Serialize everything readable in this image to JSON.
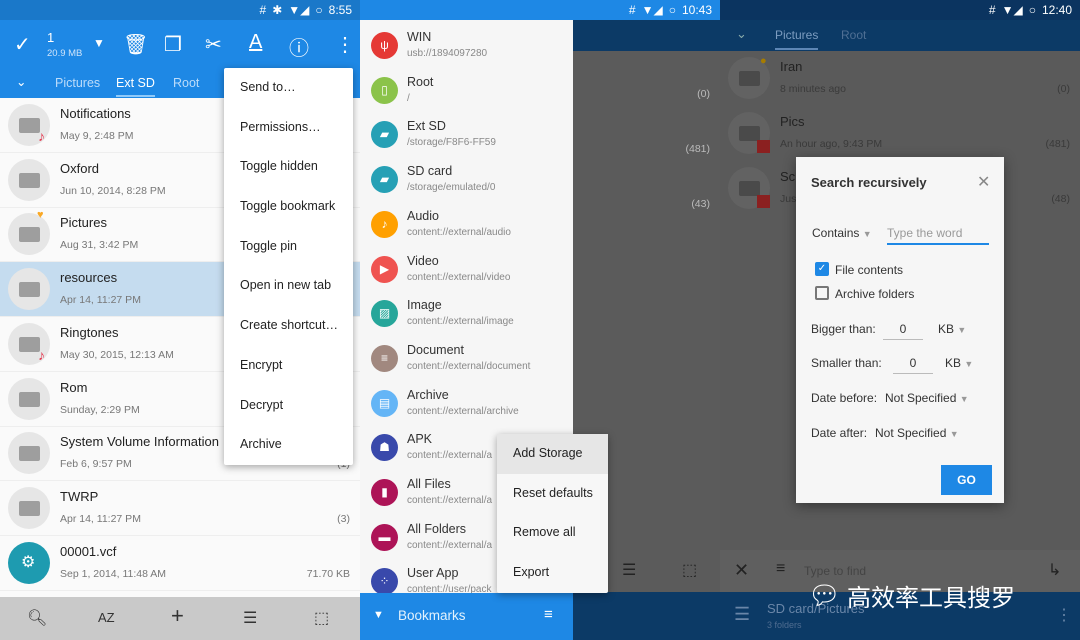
{
  "panel1": {
    "status": {
      "time": "8:55",
      "icons": [
        "hash-icon",
        "bluetooth-icon",
        "wifi-icon",
        "signal-icon",
        "battery-icon"
      ]
    },
    "selection": {
      "count": "1",
      "size": "20.9 MB"
    },
    "tabs": [
      "Pictures",
      "Ext SD",
      "Root"
    ],
    "active_tab": "Ext SD",
    "files": [
      {
        "name": "Notifications",
        "date": "May 9, 2:48 PM",
        "size": "",
        "badge": "music"
      },
      {
        "name": "Oxford",
        "date": "Jun 10, 2014, 8:28 PM",
        "size": "",
        "badge": ""
      },
      {
        "name": "Pictures",
        "date": "Aug 31, 3:42 PM",
        "size": "",
        "badge": "heart"
      },
      {
        "name": "resources",
        "date": "Apr 14, 11:27 PM",
        "size": "",
        "badge": "",
        "selected": true
      },
      {
        "name": "Ringtones",
        "date": "May 30, 2015, 12:13 AM",
        "size": "",
        "badge": "music"
      },
      {
        "name": "Rom",
        "date": "Sunday, 2:29 PM",
        "size": "",
        "badge": ""
      },
      {
        "name": "System Volume Information",
        "date": "Feb 6, 9:57 PM",
        "size": "(1)",
        "badge": ""
      },
      {
        "name": "TWRP",
        "date": "Apr 14, 11:27 PM",
        "size": "(3)",
        "badge": ""
      },
      {
        "name": "00001.vcf",
        "date": "Sep 1, 2014, 11:48 AM",
        "size": "71.70 KB",
        "badge": "gear"
      }
    ],
    "menu": [
      "Send to…",
      "Permissions…",
      "Toggle hidden",
      "Toggle bookmark",
      "Toggle pin",
      "Open in new tab",
      "Create shortcut…",
      "Encrypt",
      "Decrypt",
      "Archive"
    ],
    "bottom": {
      "sort_label": "AZ"
    }
  },
  "panel2": {
    "status": {
      "time": "10:43"
    },
    "bookmarks": [
      {
        "title": "WIN",
        "sub": "usb://1894097280",
        "color": "#e53935",
        "icon": "usb-icon"
      },
      {
        "title": "Root",
        "sub": "/",
        "color": "#8bc34a",
        "icon": "phone-icon"
      },
      {
        "title": "Ext SD",
        "sub": "/storage/F8F6-FF59",
        "color": "#26a0b5",
        "icon": "sd-card-icon"
      },
      {
        "title": "SD card",
        "sub": "/storage/emulated/0",
        "color": "#26a0b5",
        "icon": "sd-card-icon"
      },
      {
        "title": "Audio",
        "sub": "content://external/audio",
        "color": "#ffa000",
        "icon": "music-icon"
      },
      {
        "title": "Video",
        "sub": "content://external/video",
        "color": "#ef5350",
        "icon": "play-icon"
      },
      {
        "title": "Image",
        "sub": "content://external/image",
        "color": "#26a69a",
        "icon": "image-icon"
      },
      {
        "title": "Document",
        "sub": "content://external/document",
        "color": "#a1887f",
        "icon": "document-icon"
      },
      {
        "title": "Archive",
        "sub": "content://external/archive",
        "color": "#64b5f6",
        "icon": "archive-icon"
      },
      {
        "title": "APK",
        "sub": "content://external/a",
        "color": "#3949ab",
        "icon": "android-icon"
      },
      {
        "title": "All Files",
        "sub": "content://external/a",
        "color": "#ad1457",
        "icon": "file-icon"
      },
      {
        "title": "All Folders",
        "sub": "content://external/a",
        "color": "#ad1457",
        "icon": "folder-icon"
      },
      {
        "title": "User App",
        "sub": "content://user/pack",
        "color": "#3949ab",
        "icon": "apps-icon"
      }
    ],
    "counts": [
      "(0)",
      "(481)",
      "(43)"
    ],
    "menu": [
      "Add Storage",
      "Reset defaults",
      "Remove all",
      "Export"
    ],
    "footer": "Bookmarks"
  },
  "panel3": {
    "status": {
      "time": "12:40"
    },
    "tabs": [
      "Pictures",
      "Root"
    ],
    "files": [
      {
        "name": "Iran",
        "date": "8 minutes ago",
        "size": "(0)"
      },
      {
        "name": "Pics",
        "date": "An hour ago, 9:43 PM",
        "size": "(481)"
      },
      {
        "name": "Sc",
        "date": "Jus",
        "size": "(48)"
      }
    ],
    "dialog": {
      "title": "Search recursively",
      "match_mode": "Contains",
      "word_placeholder": "Type the word",
      "file_contents": {
        "label": "File contents",
        "checked": true
      },
      "archive_folders": {
        "label": "Archive folders",
        "checked": false
      },
      "bigger_label": "Bigger than:",
      "bigger_value": "0",
      "bigger_unit": "KB",
      "smaller_label": "Smaller than:",
      "smaller_value": "0",
      "smaller_unit": "KB",
      "date_before_label": "Date before:",
      "date_before_value": "Not Specified",
      "date_after_label": "Date after:",
      "date_after_value": "Not Specified",
      "go": "GO"
    },
    "search_placeholder": "Type to find",
    "footer": {
      "path": "SD card/Pictures",
      "sub": "3 folders"
    },
    "watermark": "高效率工具搜罗"
  }
}
